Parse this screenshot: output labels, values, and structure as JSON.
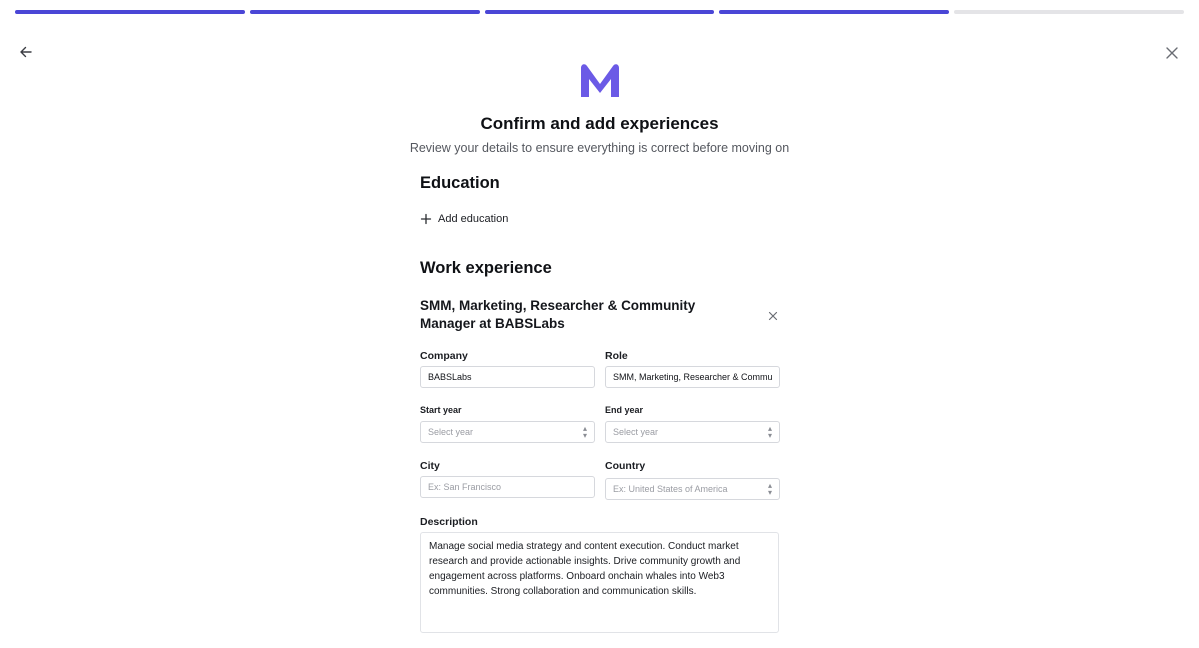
{
  "progress": {
    "total_steps": 5,
    "completed_steps": 4
  },
  "header": {
    "title": "Confirm and add experiences",
    "subtitle": "Review your details to ensure everything is correct before moving on"
  },
  "education": {
    "section_title": "Education",
    "add_label": "Add education"
  },
  "work": {
    "section_title": "Work experience",
    "entry_title": "SMM, Marketing, Researcher & Community Manager at BABSLabs",
    "company": {
      "label": "Company",
      "value": "BABSLabs"
    },
    "role": {
      "label": "Role",
      "value": "SMM, Marketing, Researcher & Community Manager"
    },
    "start_year": {
      "label": "Start year",
      "placeholder": "Select year"
    },
    "end_year": {
      "label": "End year",
      "placeholder": "Select year"
    },
    "city": {
      "label": "City",
      "placeholder": "Ex: San Francisco"
    },
    "country": {
      "label": "Country",
      "placeholder": "Ex: United States of America"
    },
    "description": {
      "label": "Description",
      "value": "Manage social media strategy and content execution. Conduct market research and provide actionable insights. Drive community growth and engagement across platforms. Onboard onchain whales into Web3 communities. Strong collaboration and communication skills."
    }
  },
  "colors": {
    "accent": "#4a46d6",
    "logo": "#6b5ae6",
    "track": "#e4e4e7"
  },
  "icons": {
    "back": "arrow-left-icon",
    "close": "close-icon",
    "add": "plus-icon",
    "remove": "close-icon",
    "select": "chevron-updown-icon",
    "logo": "m-logo-icon"
  }
}
